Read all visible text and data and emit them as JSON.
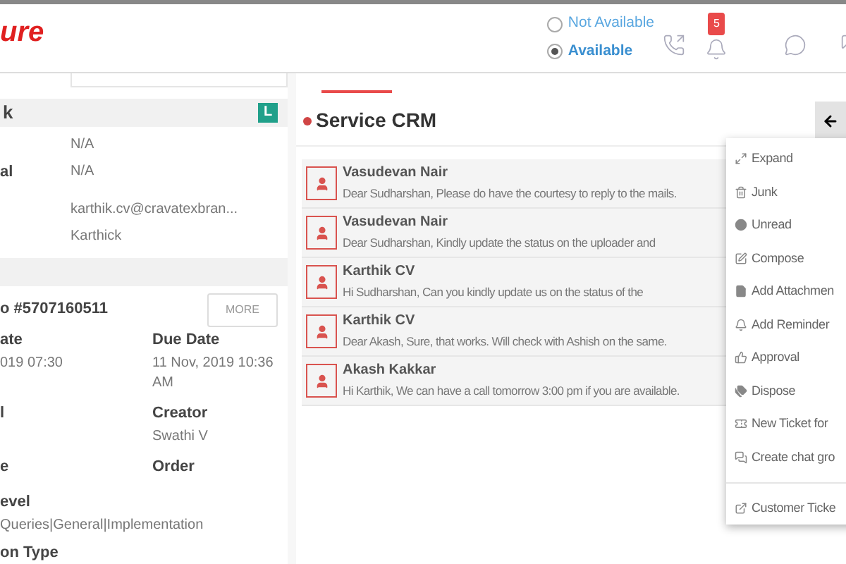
{
  "header": {
    "logo": "ure",
    "availability": [
      {
        "label": "Not Available",
        "selected": false
      },
      {
        "label": "Available",
        "selected": true
      }
    ],
    "notification_count": "5"
  },
  "contact": {
    "name": "k",
    "badge": "L",
    "fields": [
      {
        "value": "N/A"
      },
      {
        "label": "al",
        "value": "N/A"
      },
      {
        "value": "karthik.cv@cravatexbran..."
      },
      {
        "value": "Karthick"
      }
    ]
  },
  "ticket": {
    "number": "o #5707160511",
    "more_button": "MORE",
    "fields": [
      {
        "label": "ate",
        "value": "019 07:30"
      },
      {
        "label": "Due Date",
        "value": "11 Nov, 2019 10:36 AM"
      },
      {
        "label": "l"
      },
      {
        "label": "Creator",
        "value": "Swathi V"
      },
      {
        "label": "e"
      },
      {
        "label": "Order"
      }
    ],
    "level": {
      "label": "evel",
      "value": "Queries|General|Implementation"
    },
    "type_label": "on Type"
  },
  "conversation": {
    "title": "Service CRM",
    "messages": [
      {
        "sender": "Vasudevan Nair",
        "preview": "Dear Sudharshan, Please do have the courtesy to reply to the mails."
      },
      {
        "sender": "Vasudevan Nair",
        "preview": "Dear Sudharshan,  Kindly update the status on the uploader and"
      },
      {
        "sender": "Karthik CV",
        "preview": "Hi Sudharshan, Can you kindly update us on the status of the"
      },
      {
        "sender": "Karthik CV",
        "preview": "Dear Akash, Sure, that works. Will check with Ashish on the same."
      },
      {
        "sender": "Akash Kakkar",
        "preview": "Hi Karthik, We can have a call tomorrow 3:00 pm if you are available."
      }
    ]
  },
  "menu": {
    "items": [
      {
        "kind": "expand",
        "label": "Expand"
      },
      {
        "kind": "junk",
        "label": "Junk"
      },
      {
        "kind": "unread",
        "label": "Unread"
      },
      {
        "kind": "compose",
        "label": "Compose"
      },
      {
        "kind": "attachment",
        "label": "Add Attachmen"
      },
      {
        "kind": "reminder",
        "label": "Add Reminder"
      },
      {
        "kind": "approval",
        "label": "Approval"
      },
      {
        "kind": "dispose",
        "label": "Dispose"
      },
      {
        "kind": "ticket",
        "label": "New Ticket for"
      },
      {
        "kind": "chat",
        "label": "Create chat gro"
      },
      {
        "kind": "external",
        "label": "Customer Ticke"
      }
    ]
  }
}
